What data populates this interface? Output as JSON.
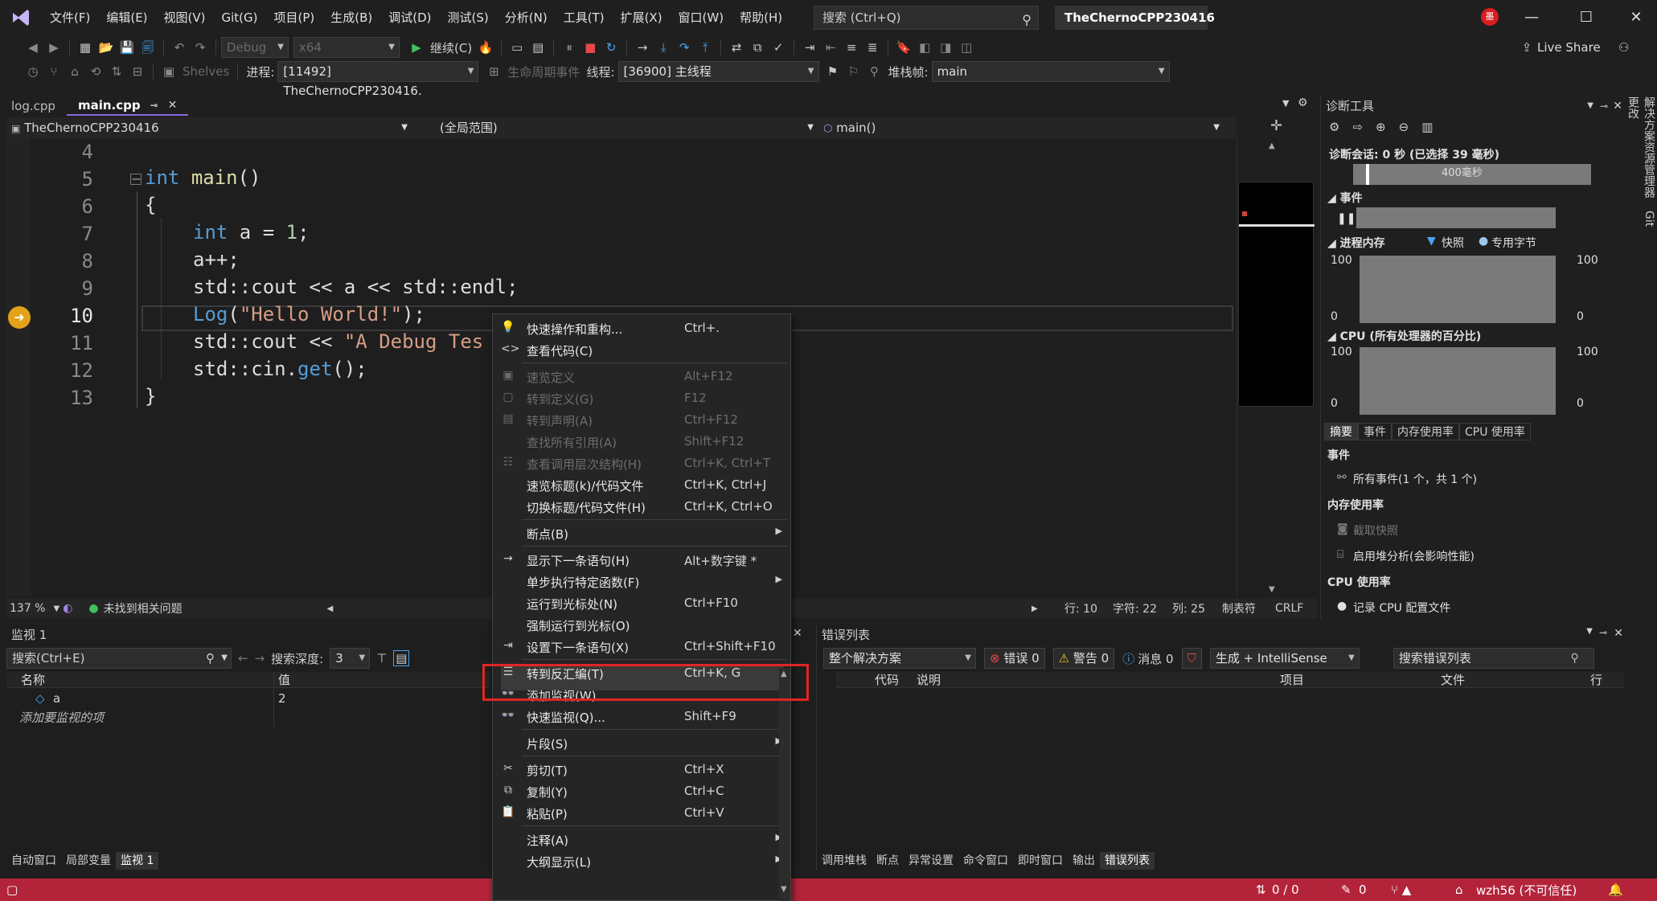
{
  "app": {
    "menu": [
      "文件(F)",
      "编辑(E)",
      "视图(V)",
      "Git(G)",
      "项目(P)",
      "生成(B)",
      "调试(D)",
      "测试(S)",
      "分析(N)",
      "工具(T)",
      "扩展(X)",
      "窗口(W)",
      "帮助(H)"
    ],
    "search_placeholder": "搜索 (Ctrl+Q)",
    "solution_name": "TheChernoCPP230416",
    "avatar_text": "墨",
    "live_share": "Live Share"
  },
  "toolbar1": {
    "config": "Debug",
    "platform": "x64",
    "continue_label": "继续(C)"
  },
  "toolbar2": {
    "shelves": "Shelves",
    "process_label": "进程:",
    "process_value": "[11492] TheChernoCPP230416.",
    "lifecycle_label": "生命周期事件",
    "thread_label": "线程:",
    "thread_value": "[36900] 主线程",
    "stackframe_label": "堆栈帧:",
    "stackframe_value": "main"
  },
  "tabs": [
    {
      "label": "log.cpp"
    },
    {
      "label": "main.cpp"
    }
  ],
  "navbar": {
    "project": "TheChernoCPP230416",
    "scope": "(全局范围)",
    "member": "main()"
  },
  "code": {
    "line_numbers": [
      "4",
      "5",
      "6",
      "7",
      "8",
      "9",
      "10",
      "11",
      "12",
      "13"
    ],
    "current_line": "10"
  },
  "editor_status": {
    "zoom": "137 %",
    "issues": "未找到相关问题",
    "line": "行: 10",
    "char": "字符: 22",
    "col": "列: 25",
    "tabs": "制表符",
    "eol": "CRLF"
  },
  "diagnostics": {
    "title": "诊断工具",
    "session": "诊断会话: 0 秒 (已选择 39 毫秒)",
    "timeline_label": "400毫秒",
    "events_header": "事件",
    "memory_header": "进程内存",
    "snapshot_legend": "快照",
    "private_bytes_legend": "专用字节",
    "mem_max": "100",
    "mem_min": "0",
    "cpu_header": "CPU (所有处理器的百分比)",
    "cpu_max": "100",
    "cpu_min": "0",
    "tabs": [
      "摘要",
      "事件",
      "内存使用率",
      "CPU 使用率"
    ],
    "summary_events": "事件",
    "all_events": "所有事件(1 个，共 1 个)",
    "memory_usage": "内存使用率",
    "take_snapshot": "截取快照",
    "heap_profiling": "启用堆分析(会影响性能)",
    "cpu_usage": "CPU 使用率",
    "record_cpu": "记录 CPU 配置文件"
  },
  "side_tabs": [
    "解决方案资源管理器",
    "Git 更改"
  ],
  "watch": {
    "title": "监视 1",
    "search_placeholder": "搜索(Ctrl+E)",
    "depth_label": "搜索深度:",
    "depth_value": "3",
    "col_name": "名称",
    "col_value": "值",
    "rows": [
      {
        "name": "a",
        "value": "2"
      }
    ],
    "add_hint": "添加要监视的项",
    "bottom_tabs": [
      "自动窗口",
      "局部变量",
      "监视 1"
    ]
  },
  "errors": {
    "title": "错误列表",
    "scope": "整个解决方案",
    "errors_btn": "错误 0",
    "warnings_btn": "警告 0",
    "messages_btn": "消息 0",
    "build_filter": "生成 + IntelliSense",
    "search_placeholder": "搜索错误列表",
    "columns": [
      "代码",
      "说明",
      "项目",
      "文件",
      "行"
    ],
    "bottom_tabs": [
      "调用堆栈",
      "断点",
      "异常设置",
      "命令窗口",
      "即时窗口",
      "输出",
      "错误列表"
    ]
  },
  "statusbar": {
    "git_sync": "0 / 0",
    "pending": "0",
    "user": "wzh56 (不可信任)"
  },
  "context_menu": {
    "items": [
      {
        "label": "快速操作和重构...",
        "shortcut": "Ctrl+.",
        "icon": "lightbulb-icon",
        "glyph": "💡",
        "disabled": false,
        "sub": false
      },
      {
        "label": "查看代码(C)",
        "shortcut": "",
        "icon": "code-icon",
        "glyph": "<>",
        "disabled": false,
        "sub": false
      },
      {
        "label": "速览定义",
        "shortcut": "Alt+F12",
        "icon": "peek-icon",
        "glyph": "▣",
        "disabled": true,
        "sub": false
      },
      {
        "label": "转到定义(G)",
        "shortcut": "F12",
        "icon": "goto-def-icon",
        "glyph": "▢",
        "disabled": true,
        "sub": false
      },
      {
        "label": "转到声明(A)",
        "shortcut": "Ctrl+F12",
        "icon": "goto-decl-icon",
        "glyph": "▤",
        "disabled": true,
        "sub": false
      },
      {
        "label": "查找所有引用(A)",
        "shortcut": "Shift+F12",
        "icon": "",
        "glyph": "",
        "disabled": true,
        "sub": false
      },
      {
        "label": "查看调用层次结构(H)",
        "shortcut": "Ctrl+K, Ctrl+T",
        "icon": "call-hierarchy-icon",
        "glyph": "☷",
        "disabled": true,
        "sub": false
      },
      {
        "label": "速览标题(k)/代码文件",
        "shortcut": "Ctrl+K, Ctrl+J",
        "icon": "",
        "glyph": "",
        "disabled": false,
        "sub": false
      },
      {
        "label": "切换标题/代码文件(H)",
        "shortcut": "Ctrl+K, Ctrl+O",
        "icon": "",
        "glyph": "",
        "disabled": false,
        "sub": false
      },
      {
        "label": "断点(B)",
        "shortcut": "",
        "icon": "",
        "glyph": "",
        "disabled": false,
        "sub": true
      },
      {
        "label": "显示下一条语句(H)",
        "shortcut": "Alt+数字键 *",
        "icon": "arrow-right-icon",
        "glyph": "→",
        "disabled": false,
        "sub": false
      },
      {
        "label": "单步执行特定函数(F)",
        "shortcut": "",
        "icon": "",
        "glyph": "",
        "disabled": false,
        "sub": true
      },
      {
        "label": "运行到光标处(N)",
        "shortcut": "Ctrl+F10",
        "icon": "",
        "glyph": "",
        "disabled": false,
        "sub": false
      },
      {
        "label": "强制运行到光标(O)",
        "shortcut": "",
        "icon": "",
        "glyph": "",
        "disabled": false,
        "sub": false
      },
      {
        "label": "设置下一条语句(X)",
        "shortcut": "Ctrl+Shift+F10",
        "icon": "set-next-icon",
        "glyph": "⇥",
        "disabled": false,
        "sub": false
      },
      {
        "label": "转到反汇编(T)",
        "shortcut": "Ctrl+K, G",
        "icon": "disassembly-icon",
        "glyph": "☰",
        "disabled": false,
        "sub": false
      },
      {
        "label": "添加监视(W)",
        "shortcut": "",
        "icon": "watch-icon",
        "glyph": "👓",
        "disabled": false,
        "sub": false
      },
      {
        "label": "快速监视(Q)...",
        "shortcut": "Shift+F9",
        "icon": "quickwatch-icon",
        "glyph": "👓",
        "disabled": false,
        "sub": false
      },
      {
        "label": "片段(S)",
        "shortcut": "",
        "icon": "",
        "glyph": "",
        "disabled": false,
        "sub": true
      },
      {
        "label": "剪切(T)",
        "shortcut": "Ctrl+X",
        "icon": "cut-icon",
        "glyph": "✂",
        "disabled": false,
        "sub": false
      },
      {
        "label": "复制(Y)",
        "shortcut": "Ctrl+C",
        "icon": "copy-icon",
        "glyph": "⧉",
        "disabled": false,
        "sub": false
      },
      {
        "label": "粘贴(P)",
        "shortcut": "Ctrl+V",
        "icon": "paste-icon",
        "glyph": "📋",
        "disabled": false,
        "sub": false
      },
      {
        "label": "注释(A)",
        "shortcut": "",
        "icon": "",
        "glyph": "",
        "disabled": false,
        "sub": true
      },
      {
        "label": "大纲显示(L)",
        "shortcut": "",
        "icon": "",
        "glyph": "",
        "disabled": false,
        "sub": true
      }
    ]
  },
  "colors": {
    "accent": "#8a6ae0",
    "statusbar": "#b3243b",
    "highlight_frame": "#e02525",
    "breakpoint_arrow": "#e3a21a"
  }
}
